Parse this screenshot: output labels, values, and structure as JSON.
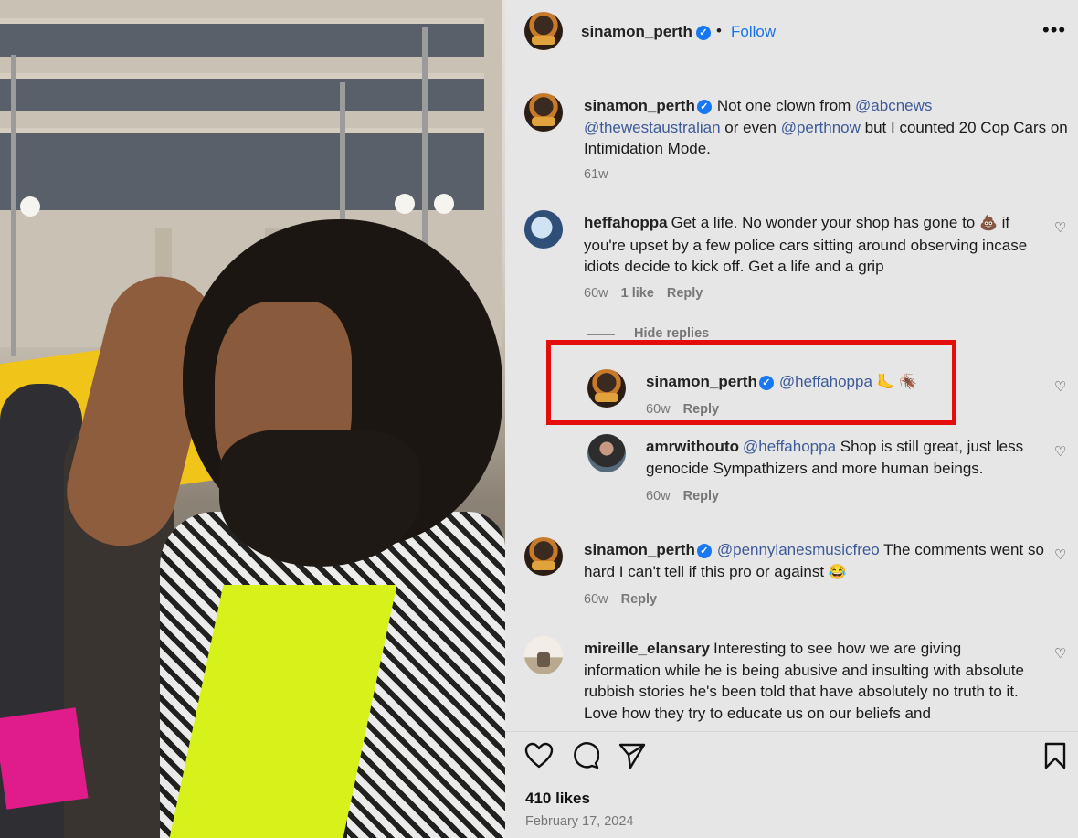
{
  "post": {
    "author": "sinamon_perth",
    "follow_label": "Follow",
    "separator": "•",
    "more_label": "•••"
  },
  "caption": {
    "user": "sinamon_perth",
    "text_1": "Not one clown from ",
    "mention_1": "@abcnews",
    "mention_2": "@thewestaustralian",
    "text_2": " or even ",
    "mention_3": "@perthnow",
    "text_3": " but I counted 20 Cop Cars on Intimidation Mode.",
    "time": "61w"
  },
  "comments": [
    {
      "user": "heffahoppa",
      "text_1": "Get a life. No wonder your shop has gone to ",
      "emoji_1": "💩",
      "text_2": " if you're upset by a few police cars sitting around observing incase idiots decide to kick off. Get a life and a grip",
      "time": "60w",
      "likes": "1 like",
      "reply": "Reply"
    },
    {
      "user": "sinamon_perth",
      "mention": "@heffahoppa",
      "emoji": "🦶 🪳",
      "time": "60w",
      "reply": "Reply"
    },
    {
      "user": "amrwithouto",
      "mention": "@heffahoppa",
      "text": " Shop is still great, just less genocide Sympathizers and more human beings.",
      "time": "60w",
      "reply": "Reply"
    },
    {
      "user": "sinamon_perth",
      "mention": "@pennylanesmusicfreo",
      "text": " The comments went so hard I can't tell if this pro or against ",
      "emoji": "😂",
      "time": "60w",
      "reply": "Reply"
    },
    {
      "user": "mireille_elansary",
      "text": "Interesting to see how we are giving information while he is being abusive and insulting with absolute rubbish stories he's been told that have absolutely no truth to it. Love how they try to educate us on our beliefs and"
    }
  ],
  "hide_replies": "Hide replies",
  "footer": {
    "likes": "410 likes",
    "date": "February 17, 2024"
  },
  "colors": {
    "verified": "#1877f2",
    "follow": "#1a73e8",
    "mention": "#3d5a99",
    "highlight": "#e30d0d"
  }
}
